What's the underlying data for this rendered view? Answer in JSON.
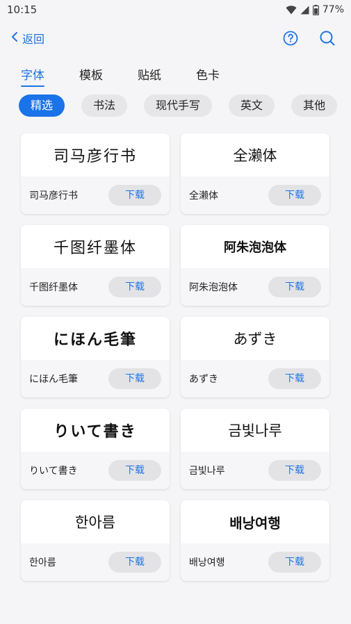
{
  "status": {
    "time": "10:15",
    "battery": "77%"
  },
  "header": {
    "back_label": "返回"
  },
  "tabs": [
    {
      "label": "字体",
      "active": true
    },
    {
      "label": "模板",
      "active": false
    },
    {
      "label": "贴纸",
      "active": false
    },
    {
      "label": "色卡",
      "active": false
    }
  ],
  "chips": [
    {
      "label": "精选",
      "active": true
    },
    {
      "label": "书法",
      "active": false
    },
    {
      "label": "现代手写",
      "active": false
    },
    {
      "label": "英文",
      "active": false
    },
    {
      "label": "其他",
      "active": false
    }
  ],
  "download_label": "下载",
  "fonts": [
    {
      "preview": "司马彦行书",
      "name": "司马彦行书"
    },
    {
      "preview": "全濑体",
      "name": "全濑体"
    },
    {
      "preview": "千图纤墨体",
      "name": "千图纤墨体"
    },
    {
      "preview": "阿朱泡泡体",
      "name": "阿朱泡泡体"
    },
    {
      "preview": "にほん毛筆",
      "name": "にほん毛筆"
    },
    {
      "preview": "あずき",
      "name": "あずき"
    },
    {
      "preview": "りいて書き",
      "name": "りいて書き"
    },
    {
      "preview": "금빛나루",
      "name": "금빛나루"
    },
    {
      "preview": "한아름",
      "name": "한아름"
    },
    {
      "preview": "배낭여행",
      "name": "배낭여행"
    }
  ],
  "colors": {
    "accent": "#1e74e4",
    "chip_active": "#1a73e8"
  },
  "icons": [
    "back-chevron-icon",
    "help-circle-icon",
    "search-icon",
    "wifi-icon",
    "signal-icon",
    "battery-icon"
  ]
}
